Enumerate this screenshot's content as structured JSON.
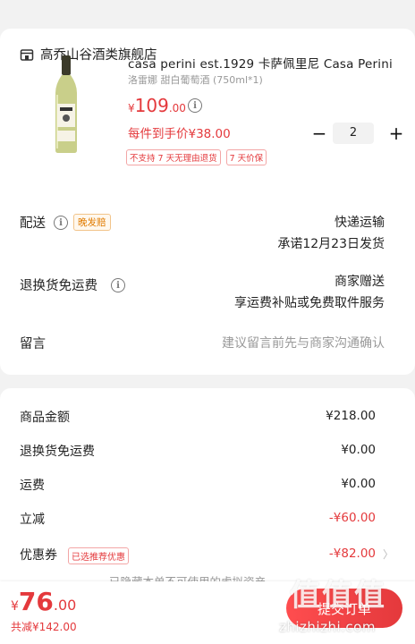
{
  "shop": {
    "name": "高乔山谷酒类旗舰店"
  },
  "product": {
    "title": "casa perini est.1929 卡萨佩里尼 Casa Perini",
    "spec": "洛雷娜 甜白葡萄酒 (750ml*1)",
    "price_currency": "¥",
    "price_int": "109",
    "price_dec": ".00",
    "hand_price": "每件到手价¥38.00",
    "tags": [
      "不支持 7 天无理由退货",
      "7 天价保"
    ],
    "quantity": "2",
    "minus": "−",
    "plus": "+"
  },
  "delivery": {
    "label": "配送",
    "badge": "晚发赔",
    "method": "快递运输",
    "promise": "承诺12月23日发货"
  },
  "return_shipping": {
    "label": "退换货免运费",
    "value": "商家赠送",
    "desc": "享运费补贴或免费取件服务"
  },
  "message": {
    "label": "留言",
    "placeholder": "建议留言前先与商家沟通确认"
  },
  "summary": {
    "rows": [
      {
        "label": "商品金额",
        "value": "¥218.00"
      },
      {
        "label": "退换货免运费",
        "value": "¥0.00"
      },
      {
        "label": "运费",
        "value": "¥0.00"
      },
      {
        "label": "立减",
        "value": "-¥60.00"
      },
      {
        "label": "优惠券",
        "value": "-¥82.00"
      }
    ],
    "coupon_badge": "已选推荐优惠",
    "hidden_note": "已隐藏本单不可使用的虚拟资产"
  },
  "bottom": {
    "currency": "¥",
    "total_int": "76",
    "total_dec": ".00",
    "saved": "共减¥142.00",
    "submit": "提交订单"
  },
  "watermark": {
    "logo": "值值值",
    "url": "zhizhizhi.com"
  },
  "colors": {
    "accent": "#e4393c",
    "muted": "#999999"
  }
}
